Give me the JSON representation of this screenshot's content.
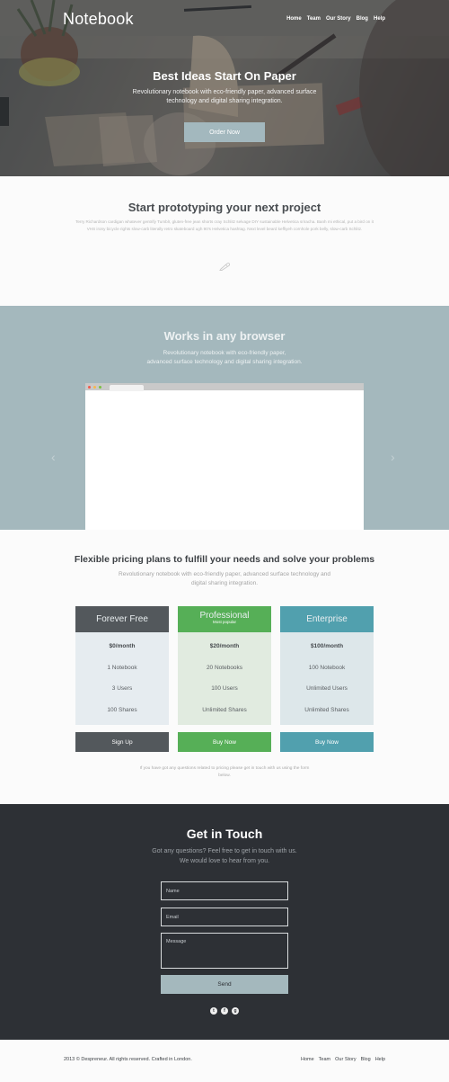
{
  "header": {
    "logo": "Notebook",
    "nav": [
      "Home",
      "Team",
      "Our Story",
      "Blog",
      "Help"
    ]
  },
  "hero": {
    "title": "Best Ideas Start On Paper",
    "subtitle": "Revolutionary notebook with eco-friendly paper, advanced surface technology and digital sharing integration.",
    "cta": "Order Now"
  },
  "prototype": {
    "title": "Start prototyping your next project",
    "body": "Terry Richardson cardigan whatever gentrify Tumblr, gluten-free jean shorts cray Schlitz selvage DIY sustainable Helvetica sriracha. Banh mi ethical, put a bird on it VHS irony bicycle rights slow-carb literally retro skateboard ugh 90's Helvetica hashtag. Next level beard keffiyeh cornhole pork belly, slow-carb Schlitz.",
    "icon": "pencil-icon"
  },
  "browser": {
    "title": "Works in any browser",
    "subtitle_line1": "Revolutionary notebook with eco-friendly paper,",
    "subtitle_line2": "advanced surface technology and digital sharing integration.",
    "prev_icon": "‹",
    "next_icon": "›",
    "window_dots": [
      "#f25a4c",
      "#f8b84e",
      "#7ac142"
    ]
  },
  "pricing": {
    "title": "Flexible pricing plans to fulfill your needs and solve your problems",
    "subtitle": "Revolutionary notebook with eco-friendly paper, advanced surface technology and digital sharing integration.",
    "plans": [
      {
        "name": "Forever Free",
        "tag": "",
        "features": [
          "$0/month",
          "1 Notebook",
          "3 Users",
          "100 Shares"
        ],
        "cta": "Sign Up",
        "color": "#53585c",
        "body_color": "#e6ecf0"
      },
      {
        "name": "Professional",
        "tag": "Most popular",
        "features": [
          "$20/month",
          "20 Notebooks",
          "100 Users",
          "Unlimited Shares"
        ],
        "cta": "Buy Now",
        "color": "#56af57",
        "body_color": "#e1ebe0"
      },
      {
        "name": "Enterprise",
        "tag": "",
        "features": [
          "$100/month",
          "100 Notebook",
          "Unlimited Users",
          "Unlimited Shares"
        ],
        "cta": "Buy Now",
        "color": "#51a0ae",
        "body_color": "#dde7ea"
      }
    ],
    "note": "If you have got any questions related to pricing please get in touch with us using the form below."
  },
  "contact": {
    "title": "Get in Touch",
    "line1": "Got any questions? Feel free to get in touch with us.",
    "line2": "We would love to hear from you.",
    "name_placeholder": "Name",
    "email_placeholder": "Email",
    "message_placeholder": "Message",
    "send": "Send",
    "social": [
      {
        "name": "twitter-icon",
        "glyph": "t"
      },
      {
        "name": "facebook-icon",
        "glyph": "f"
      },
      {
        "name": "google-plus-icon",
        "glyph": "g"
      }
    ]
  },
  "footer": {
    "copyright": "2013 © Despreneur. All rights reserved. Crafted in London.",
    "nav": [
      "Home",
      "Team",
      "Our Story",
      "Blog",
      "Help"
    ]
  }
}
